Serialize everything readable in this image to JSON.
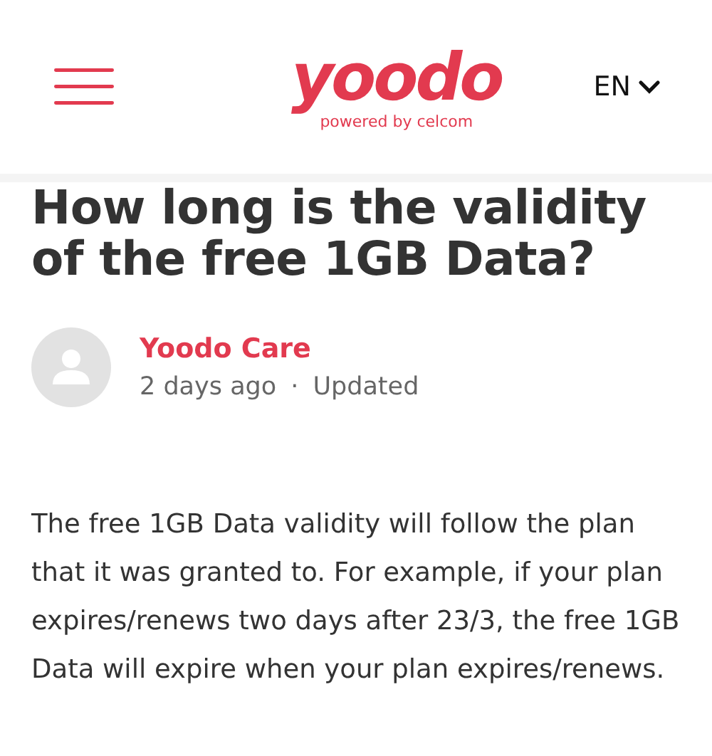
{
  "header": {
    "logo": "yoodo",
    "tagline": "powered by celcom",
    "language": "EN"
  },
  "article": {
    "title": "How long is the validity of the free 1GB Data?",
    "author": "Yoodo Care",
    "time": "2 days ago",
    "separator": "·",
    "status": "Updated",
    "body": "The free 1GB Data validity will follow the plan that it was granted to. For example, if your plan expires/renews two days after 23/3, the free 1GB Data will expire when your plan expires/renews."
  }
}
